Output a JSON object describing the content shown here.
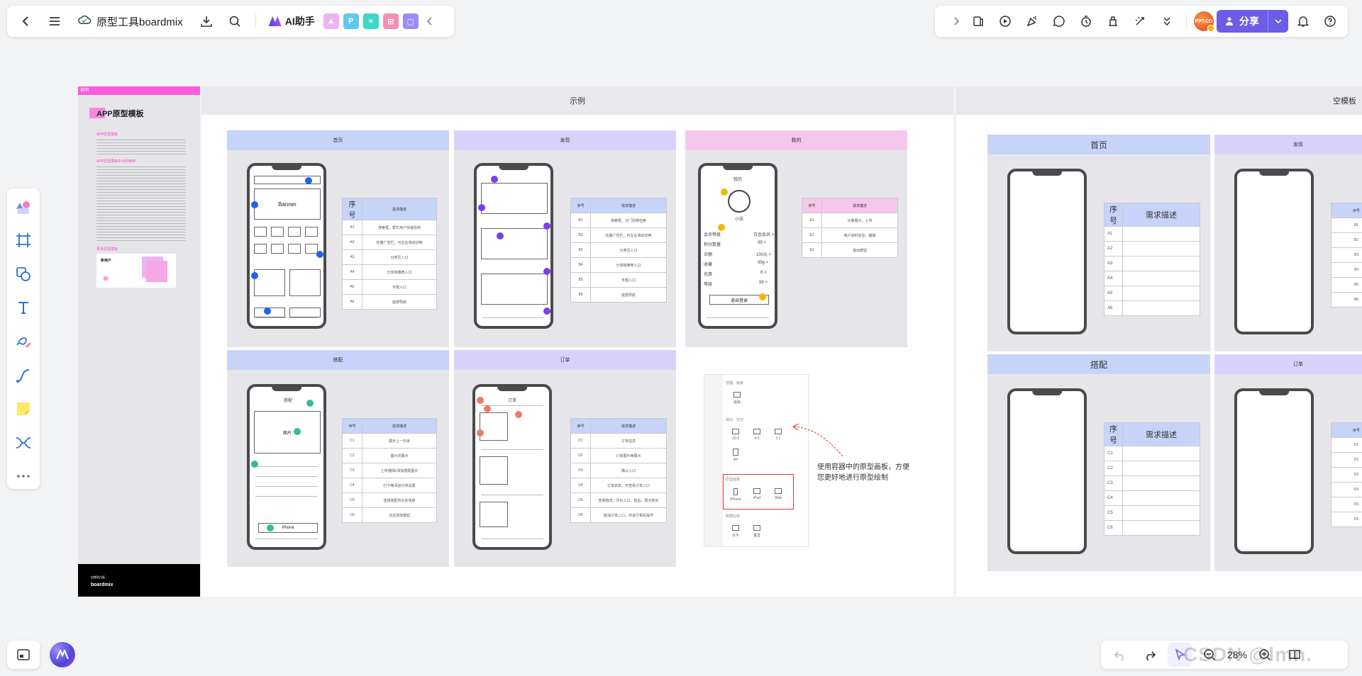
{
  "header": {
    "doc_title": "原型工具boardmix",
    "ai_label": "AI助手",
    "share_label": "分享",
    "avatar_text": "PPT.CD"
  },
  "colors": {
    "accent": "#6c5ce7",
    "card_bg": "#e6e6ea",
    "table_header": "#c7d4fa",
    "guide_pink": "#ff5ad9"
  },
  "guide": {
    "tag": "说明",
    "title": "APP原型模板",
    "section1": "APP原型模板",
    "section2": "APP原型模板中分的使用",
    "section3": "更多原型模板",
    "card_title": "新用户",
    "footer": "boardmix",
    "footer_small": "由博思白板"
  },
  "frames": {
    "example_title": "示例",
    "blank_title": "空模板"
  },
  "example_cards": [
    {
      "title": "首页"
    },
    {
      "title": "发现"
    },
    {
      "title": "我的"
    },
    {
      "title": "搭配"
    },
    {
      "title": "订单"
    }
  ],
  "home_phone": {
    "banner": "Banner"
  },
  "table_home": {
    "headers": [
      "序号",
      "需求描述"
    ],
    "rows": [
      [
        "A1",
        "搜索框，帮忙用户快速找到"
      ],
      [
        "A2",
        "轮播广告栏，可左右滑动切换"
      ],
      [
        "A3",
        "分类页入口"
      ],
      [
        "A4",
        "分享和推荐入口"
      ],
      [
        "A5",
        "专题入口"
      ],
      [
        "A6",
        "底部导航"
      ]
    ]
  },
  "table_discover": {
    "headers": [
      "序号",
      "需求描述"
    ],
    "rows": [
      [
        "B1",
        "搜索框，分门别类检索"
      ],
      [
        "B2",
        "轮播广告栏，可左右滑动切换"
      ],
      [
        "B3",
        "分类页入口"
      ],
      [
        "B4",
        "分享和推荐入口"
      ],
      [
        "B5",
        "专题入口"
      ],
      [
        "B6",
        "底部导航"
      ]
    ]
  },
  "table_mine": {
    "headers": [
      "序号",
      "需求描述"
    ],
    "rows": [
      [
        "E1",
        "头像展示，上传"
      ],
      [
        "E2",
        "用户资料信息，编辑"
      ],
      [
        "E3",
        "退出按钮"
      ]
    ]
  },
  "table_match": {
    "headers": [
      "序号",
      "需求描述"
    ],
    "rows": [
      [
        "C1",
        "展示上一日余"
      ],
      [
        "C2",
        "图片的展示"
      ],
      [
        "C3",
        "上传/删除/添加搭配图片"
      ],
      [
        "C4",
        "打卡等添加分类设置"
      ],
      [
        "C5",
        "选择搭配所在的场景"
      ],
      [
        "C6",
        "点击添加按钮"
      ]
    ]
  },
  "table_order": {
    "headers": [
      "序号",
      "需求描述"
    ],
    "rows": [
      [
        "D1",
        "订单信息"
      ],
      [
        "D2",
        "订单图片等展示"
      ],
      [
        "D3",
        "确认入口"
      ],
      [
        "D4",
        "订单状态，可查看订单入口"
      ],
      [
        "D5",
        "查看物流，评价入口，售后，再次购买"
      ],
      [
        "D6",
        "取消订单入口，并进行相关操作"
      ]
    ]
  },
  "mine_phone": {
    "name": "我的",
    "user": "小张",
    "rows": [
      "会员等级",
      "积分数量",
      "余额",
      "收藏",
      "优惠",
      "等级"
    ],
    "values": [
      "白金会员 >",
      "99 >",
      "100元 >",
      "99g >",
      "8 >",
      "99 >"
    ],
    "logout": "退出登录"
  },
  "match_phone": {
    "title": "搭配",
    "pic": "图片",
    "btn": "Phone"
  },
  "order_phone": {
    "title": "订单"
  },
  "panel": {
    "sec1": "容器、画板",
    "item1": "画板",
    "sec2": "演示、打印",
    "items2": [
      "16:9",
      "4:3",
      "1:1",
      "A4"
    ],
    "sec3": "原型画板",
    "items3": [
      "iPhone",
      "iPad",
      "Web"
    ],
    "sec4": "数据应用",
    "items4": [
      "水平",
      "垂直"
    ]
  },
  "annotation": "使用容器中的原型画板，方便您更好地进行原型绘制",
  "blank_cards": [
    {
      "title": "首页"
    },
    {
      "title": "发现"
    },
    {
      "title": "搭配"
    },
    {
      "title": "订单"
    }
  ],
  "blank_table1": {
    "headers": [
      "序号",
      "需求描述"
    ],
    "rows": [
      "A1",
      "A2",
      "A3",
      "A4",
      "A5",
      "A6"
    ]
  },
  "blank_table2": {
    "headers": [
      "序号",
      "需求描述"
    ],
    "rows": [
      "C1",
      "C2",
      "C3",
      "C4",
      "C5",
      "C6"
    ]
  },
  "blank_partial1": {
    "header": "序号",
    "rows": [
      "B1",
      "B2",
      "B3",
      "B4",
      "B5",
      "B6"
    ]
  },
  "blank_partial2": {
    "header": "序号",
    "rows": [
      "D1",
      "D2",
      "D3",
      "D4",
      "D5",
      "D6"
    ]
  },
  "bottom": {
    "zoom": "28%",
    "watermark": "CSDN @lmn."
  }
}
